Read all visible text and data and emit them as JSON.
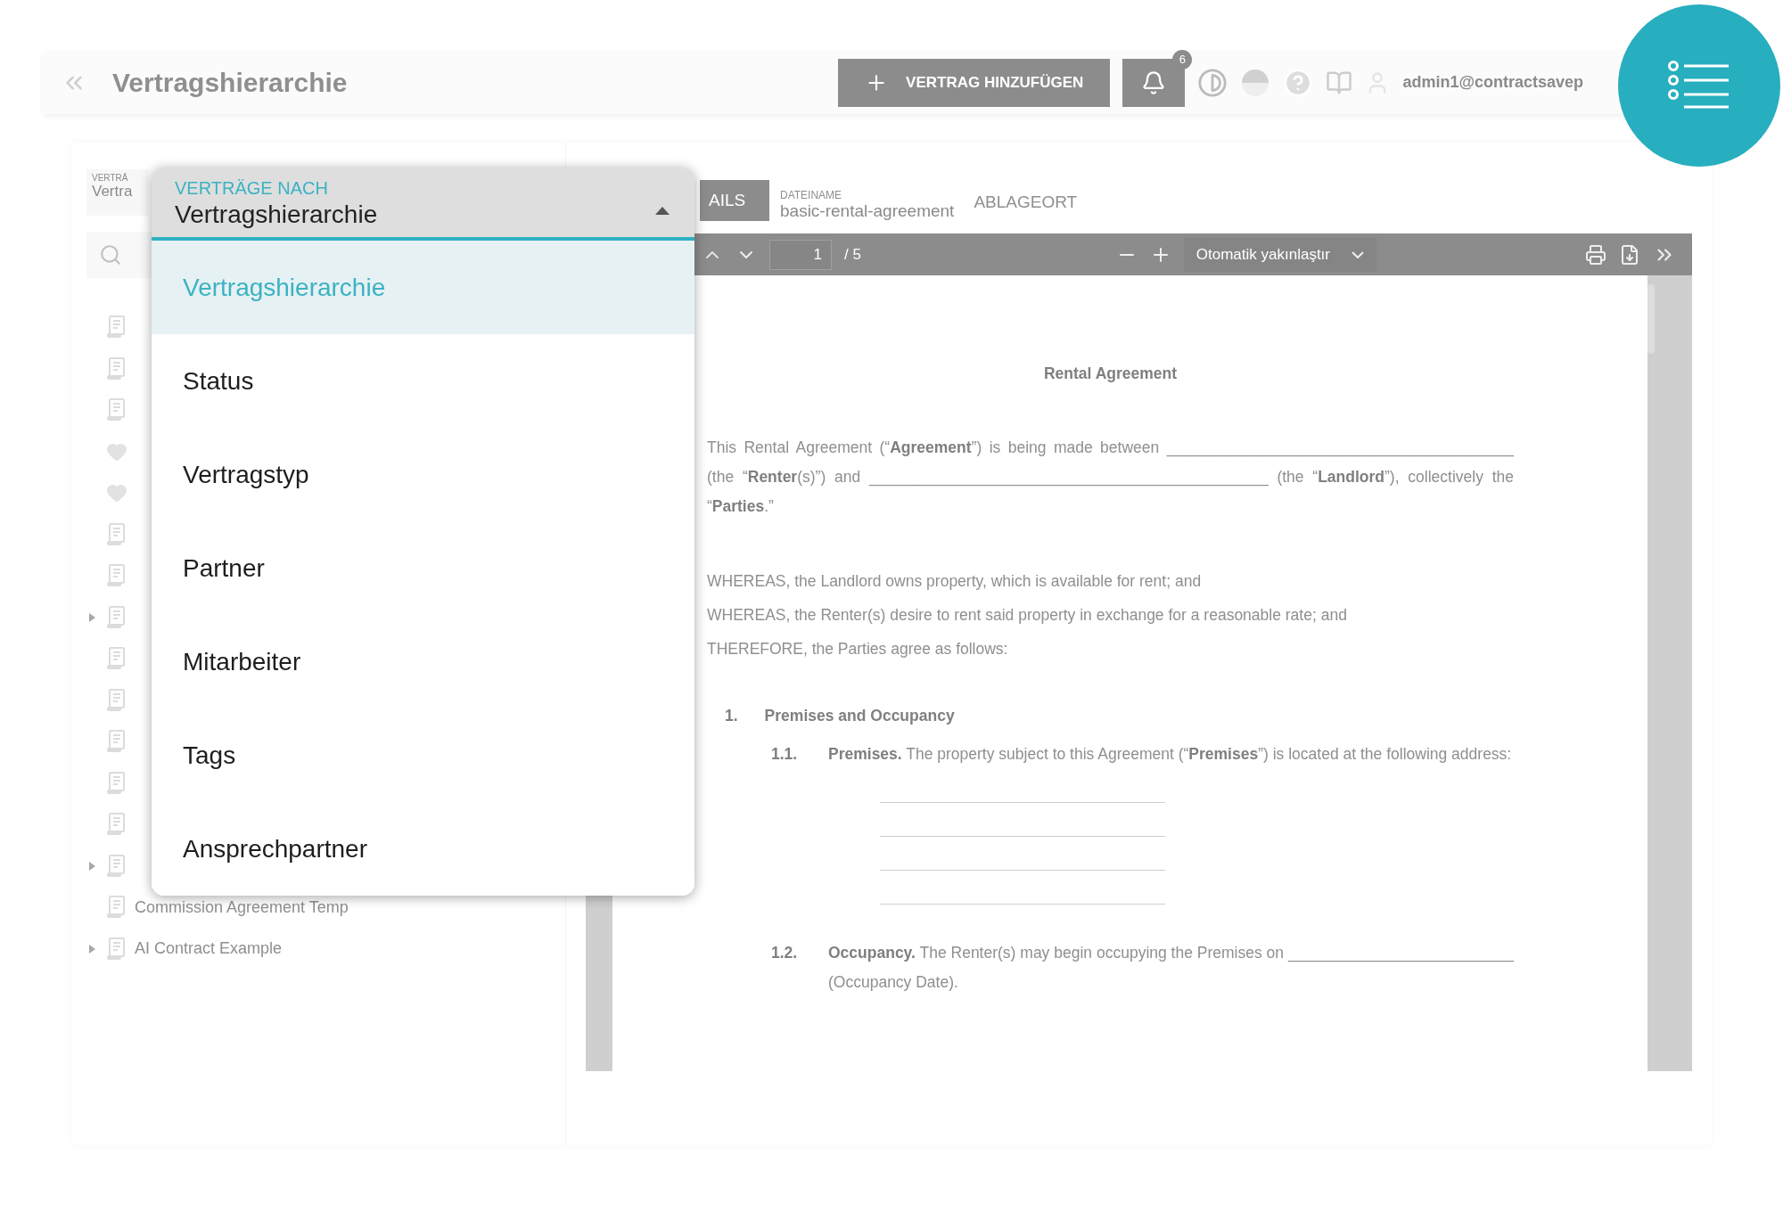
{
  "header": {
    "title": "Vertragshierarchie",
    "add_button": "VERTRAG HINZUFÜGEN",
    "notification_count": "6",
    "user_email": "admin1@contractsavep"
  },
  "sidebar": {
    "select_label": "VERTRÄ",
    "select_value": "Vertra",
    "tree": [
      {
        "kind": "document",
        "expandable": false
      },
      {
        "kind": "document",
        "expandable": false
      },
      {
        "kind": "document",
        "expandable": false
      },
      {
        "kind": "heart",
        "expandable": false
      },
      {
        "kind": "heart",
        "expandable": false
      },
      {
        "kind": "document",
        "expandable": false
      },
      {
        "kind": "document",
        "expandable": false
      },
      {
        "kind": "document",
        "expandable": true
      },
      {
        "kind": "document",
        "expandable": false
      },
      {
        "kind": "document",
        "expandable": false
      },
      {
        "kind": "document",
        "expandable": false
      },
      {
        "kind": "document",
        "expandable": false
      },
      {
        "kind": "document",
        "expandable": false
      },
      {
        "kind": "document",
        "expandable": true
      },
      {
        "kind": "document",
        "text": "Commission Agreement Temp",
        "expandable": false
      },
      {
        "kind": "document",
        "text": "AI Contract Example",
        "expandable": true
      }
    ]
  },
  "dropdown": {
    "label": "VERTRÄGE NACH",
    "value": "Vertragshierarchie",
    "expanded": true,
    "options": [
      {
        "label": "Vertragshierarchie",
        "selected": true
      },
      {
        "label": "Status",
        "selected": false
      },
      {
        "label": "Vertragstyp",
        "selected": false
      },
      {
        "label": "Partner",
        "selected": false
      },
      {
        "label": "Mitarbeiter",
        "selected": false
      },
      {
        "label": "Tags",
        "selected": false
      },
      {
        "label": "Ansprechpartner",
        "selected": false
      }
    ]
  },
  "detail": {
    "tab_label": "AILS",
    "file_label": "DATEINAME",
    "file_name": "basic-rental-agreement",
    "location_tab": "ABLAGEORT"
  },
  "pdf_toolbar": {
    "page": "1",
    "page_count": "/ 5",
    "zoom": "Otomatik yakınlaştır"
  },
  "document": {
    "title": "Rental Agreement",
    "intro": "This Rental Agreement (“**Agreement**”) is being made between ________________________________________ (the “**Renter**(s)”) and ______________________________________________ (the “**Landlord**”), collectively the “**Parties**.”",
    "recitals": [
      "WHEREAS, the Landlord owns property, which is available for rent; and",
      "WHEREAS, the Renter(s) desire to rent said property in exchange for a reasonable rate; and",
      "THEREFORE, the Parties agree as follows:"
    ],
    "section": {
      "number": "1.",
      "title": "Premises and Occupancy"
    },
    "clauses": [
      {
        "number": "1.1.",
        "text": "**Premises.**  The property subject to this Agreement (“**Premises**”) is located at the following address:",
        "blank_lines": true
      },
      {
        "number": "1.2.",
        "text": "**Occupancy.**  The Renter(s) may begin occupying the Premises on __________________________ (Occupancy Date).",
        "blank_lines": false
      }
    ]
  }
}
